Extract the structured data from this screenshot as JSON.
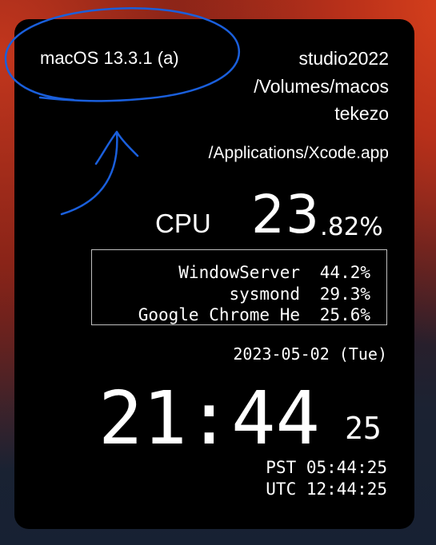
{
  "system": {
    "os_version": "macOS 13.3.1 (a)",
    "hostname": "studio2022",
    "volume": "/Volumes/macos",
    "username": "tekezo",
    "frontmost_app_path": "/Applications/Xcode.app"
  },
  "cpu": {
    "label": "CPU",
    "usage_integer": "23",
    "usage_fraction": ".82%",
    "usage_percent": 23.82
  },
  "processes": [
    {
      "name": "WindowServer",
      "cpu": "44.2%"
    },
    {
      "name": "sysmond",
      "cpu": "29.3%"
    },
    {
      "name": "Google Chrome He",
      "cpu": "25.6%"
    }
  ],
  "clock": {
    "date": "2023-05-02 (Tue)",
    "time_hm": "21:44",
    "time_seconds": "25",
    "timezones": [
      {
        "label": "PST 05:44:25"
      },
      {
        "label": "UTC 12:44:25"
      }
    ]
  },
  "colors": {
    "annotation": "#1a5fdc",
    "widget_background": "#000000",
    "text": "#ffffff",
    "process_box_border": "#bfbfbf"
  }
}
